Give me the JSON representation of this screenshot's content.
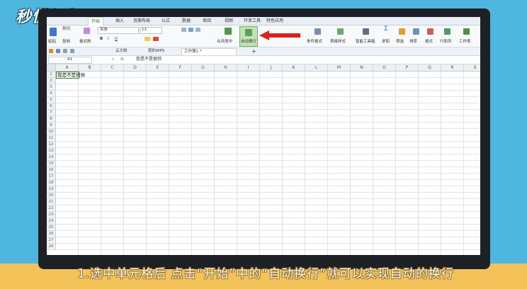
{
  "branding": {
    "logo_text": "秒懂视频"
  },
  "caption": "1.选中单元格后 点击“开始”中的“自动换行”就可以实现自动的换行",
  "menu": {
    "items": [
      "开始",
      "插入",
      "页面布局",
      "公式",
      "数据",
      "审阅",
      "视图",
      "开发工具",
      "特色应用"
    ],
    "active": "开始"
  },
  "ribbon": {
    "paste": "粘贴",
    "cut": "剪切",
    "copy": "复制",
    "format_painter": "格式刷",
    "font_name": "宋体",
    "font_size": "11",
    "bold": "B",
    "italic": "I",
    "underline": "U",
    "merge_center": "合并居中",
    "auto_wrap": "自动换行",
    "conditional_format": "条件格式",
    "table_style": "表格样式",
    "doc_assistant": "智能工具箱",
    "sum": "求和",
    "filter": "筛选",
    "sort": "排序",
    "format": "格式",
    "rows_cols": "行和列",
    "worksheet": "工作表"
  },
  "tabs": {
    "items": [
      "云文档",
      "我的WPS",
      "工作簿1 *"
    ],
    "add": "+"
  },
  "formula_bar": {
    "name_box": "A1",
    "fx": "fx",
    "content": "我是不是很帅"
  },
  "grid": {
    "columns": [
      "A",
      "B",
      "C",
      "D",
      "E",
      "F",
      "G",
      "H",
      "I",
      "J",
      "K",
      "L",
      "M",
      "N",
      "O",
      "P",
      "Q",
      "R",
      "S"
    ],
    "rows": [
      "1",
      "2",
      "3",
      "4",
      "5",
      "6",
      "7",
      "8",
      "9",
      "10",
      "11",
      "12",
      "13",
      "14",
      "15",
      "16",
      "17",
      "18",
      "19",
      "20",
      "21",
      "22",
      "23",
      "24",
      "25",
      "26",
      "27",
      "28"
    ],
    "a1_value": "我是不是很帅"
  }
}
